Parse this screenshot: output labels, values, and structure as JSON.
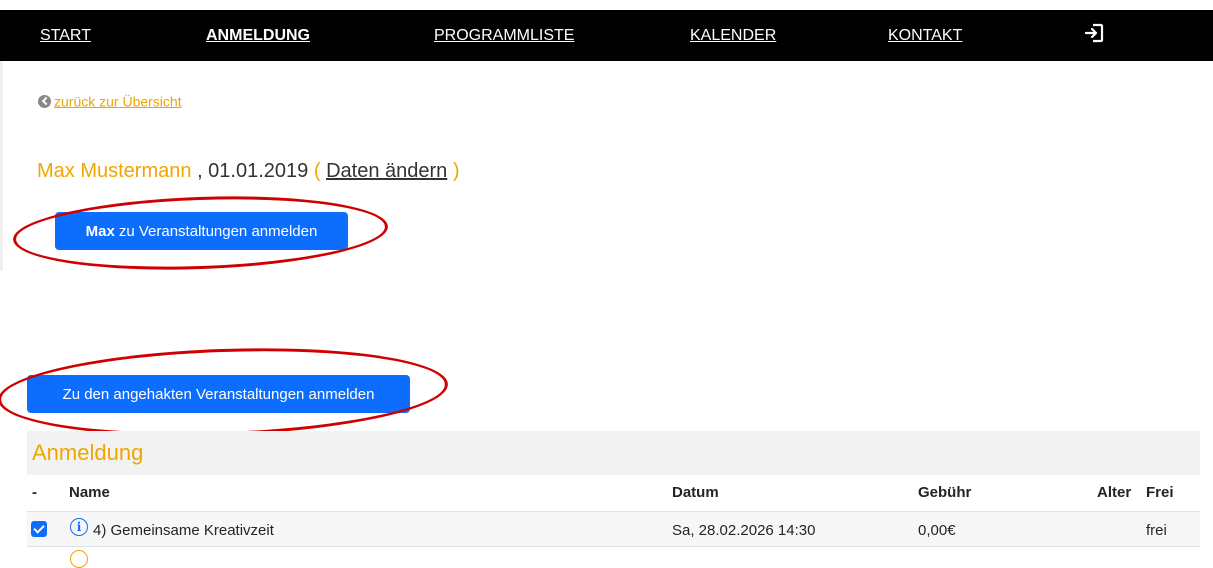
{
  "nav": {
    "items": [
      {
        "label": "START",
        "active": false
      },
      {
        "label": "ANMELDUNG",
        "active": true
      },
      {
        "label": "PROGRAMMLISTE",
        "active": false
      },
      {
        "label": "KALENDER",
        "active": false
      },
      {
        "label": "KONTAKT",
        "active": false
      }
    ],
    "logout_icon": "logout-icon"
  },
  "back_link": "zurück zur Übersicht",
  "person": {
    "name": "Max Mustermann",
    "birthdate": ", 01.01.2019",
    "open_paren": "(",
    "edit_link": "Daten ändern",
    "close_paren": ")"
  },
  "register_person_button": {
    "bold": "Max",
    "rest": "zu Veranstaltungen anmelden"
  },
  "register_checked_button": "Zu den angehakten Veranstaltungen anmelden",
  "panel": {
    "title": "Anmeldung",
    "columns": [
      "-",
      "Name",
      "Datum",
      "Gebühr",
      "Alter",
      "Frei"
    ],
    "rows": [
      {
        "checked": true,
        "name": "4) Gemeinsame Kreativzeit",
        "date": "Sa, 28.02.2026 14:30",
        "fee": "0,00€",
        "age": "",
        "free": "frei"
      }
    ]
  },
  "colors": {
    "accent": "#f0a500",
    "primary": "#0d6efd",
    "nav_bg": "#000000",
    "annotation": "#d00000"
  }
}
